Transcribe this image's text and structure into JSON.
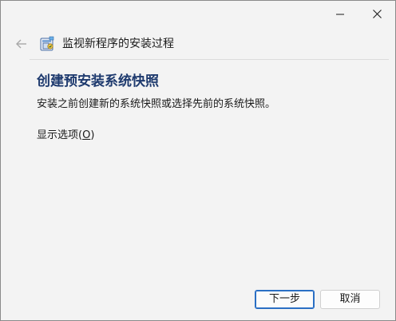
{
  "window": {
    "minimize_icon": "minimize-icon",
    "close_icon": "close-icon"
  },
  "nav": {
    "back_icon": "back-arrow-icon",
    "app_icon": "program-install-monitor-icon",
    "title": "监视新程序的安装过程"
  },
  "main": {
    "heading": "创建预安装系统快照",
    "description": "安装之前创建新的系统快照或选择先前的系统快照。",
    "options_label": "显示选项(",
    "options_mnemonic": "O",
    "options_suffix": ")"
  },
  "footer": {
    "next_label": "下一步",
    "cancel_label": "取消"
  },
  "colors": {
    "background": "#f3f3f3",
    "heading": "#1e3a6e",
    "default_button_border": "#2a6fc4"
  }
}
